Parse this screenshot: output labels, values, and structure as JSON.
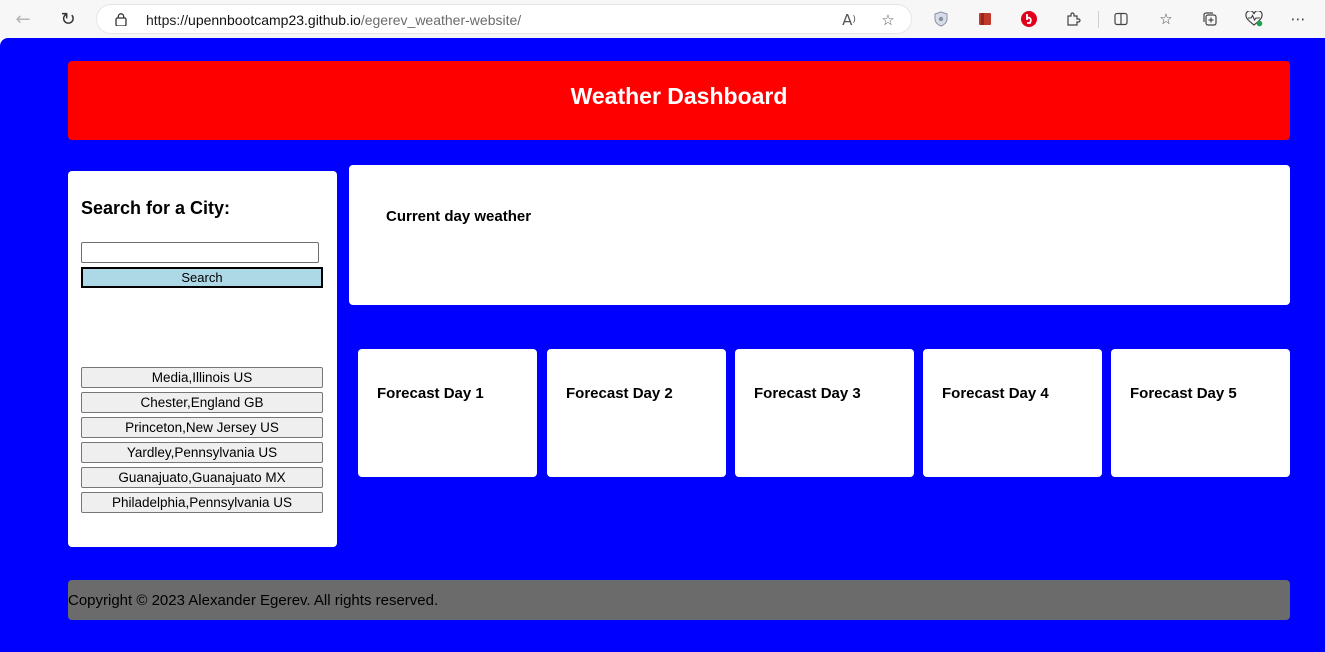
{
  "browser": {
    "url_domain": "upennbootcamp23.github.io",
    "url_path": "/egerev_weather-website/",
    "icons": [
      "back-arrow-icon",
      "refresh-icon",
      "lock-icon",
      "read-aloud-icon",
      "favorite-star-icon",
      "shield-extension-icon",
      "bookmark-extension-icon",
      "adblock-extension-icon",
      "extensions-puzzle-icon",
      "split-screen-icon",
      "favorites-icon",
      "collections-icon",
      "performance-icon",
      "more-menu-icon"
    ]
  },
  "header": {
    "title": "Weather Dashboard"
  },
  "search": {
    "title": "Search for a City:",
    "input_value": "",
    "button_label": "Search",
    "history": [
      "Media,Illinois US",
      "Chester,England GB",
      "Princeton,New Jersey US",
      "Yardley,Pennsylvania US",
      "Guanajuato,Guanajuato MX",
      "Philadelphia,Pennsylvania US"
    ]
  },
  "current": {
    "title": "Current day weather"
  },
  "forecast": [
    {
      "title": "Forecast Day 1"
    },
    {
      "title": "Forecast Day 2"
    },
    {
      "title": "Forecast Day 3"
    },
    {
      "title": "Forecast Day 4"
    },
    {
      "title": "Forecast Day 5"
    }
  ],
  "footer": {
    "text": "Copyright © 2023 Alexander Egerev. All rights reserved."
  },
  "colors": {
    "page_background": "#0000ff",
    "header_background": "#ff0000",
    "search_button": "#add8e6",
    "footer_background": "#6b6b6b"
  }
}
